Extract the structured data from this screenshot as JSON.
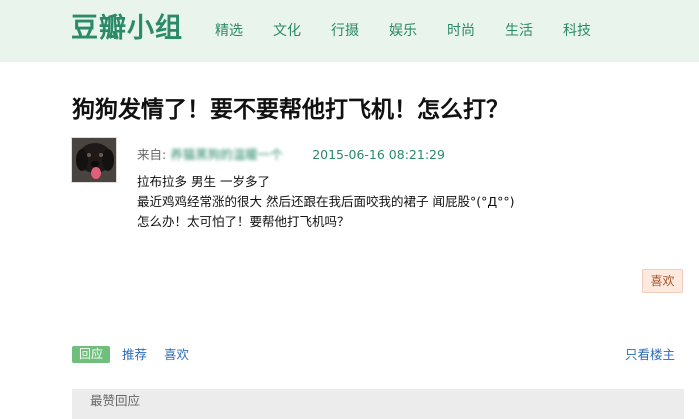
{
  "header": {
    "logo": "豆瓣小组",
    "nav": [
      "精选",
      "文化",
      "行摄",
      "娱乐",
      "时尚",
      "生活",
      "科技"
    ]
  },
  "post": {
    "title": "狗狗发情了！要不要帮他打飞机！怎么打？",
    "from_label": "来自:",
    "author": "养猫黑狗的温暖一个",
    "timestamp": "2015-06-16 08:21:29",
    "lines": [
      "拉布拉多 男生 一岁多了",
      "最近鸡鸡经常涨的很大 然后还跟在我后面咬我的裙子 闻屁股°(°Д°°)",
      "怎么办！太可怕了！要帮他打飞机吗？"
    ],
    "like_label": "喜欢"
  },
  "actions": {
    "reply": "回应",
    "recommend": "推荐",
    "like": "喜欢",
    "op_only": "只看楼主"
  },
  "section": {
    "title": "最赞回应"
  },
  "colors": {
    "brand_green": "#2b8a68",
    "header_bg": "#e9f4ed",
    "link_blue": "#2e6cb8",
    "reply_green": "#6fbe7c",
    "like_bg": "#fde9dd"
  }
}
